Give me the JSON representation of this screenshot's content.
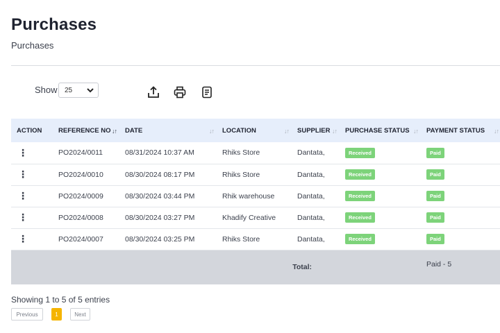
{
  "page": {
    "title": "Purchases",
    "subtitle": "Purchases"
  },
  "controls": {
    "show_label": "Show",
    "page_size": "25",
    "icons": [
      "export-icon",
      "print-icon",
      "document-icon"
    ]
  },
  "table": {
    "columns": [
      "ACTION",
      "REFERENCE NO",
      "DATE",
      "LOCATION",
      "SUPPLIER",
      "PURCHASE STATUS",
      "PAYMENT STATUS"
    ],
    "rows": [
      {
        "action": "⋮",
        "ref": "PO2024/0011",
        "date": "08/31/2024 10:37 AM",
        "location": "Rhiks Store",
        "supplier": "Dantata,",
        "purchase_status": "Received",
        "payment_status": "Paid"
      },
      {
        "action": "⋮",
        "ref": "PO2024/0010",
        "date": "08/30/2024 08:17 PM",
        "location": "Rhiks Store",
        "supplier": "Dantata,",
        "purchase_status": "Received",
        "payment_status": "Paid"
      },
      {
        "action": "⋮",
        "ref": "PO2024/0009",
        "date": "08/30/2024 03:44 PM",
        "location": "Rhik warehouse",
        "supplier": "Dantata,",
        "purchase_status": "Received",
        "payment_status": "Paid"
      },
      {
        "action": "⋮",
        "ref": "PO2024/0008",
        "date": "08/30/2024 03:27 PM",
        "location": "Khadify Creative",
        "supplier": "Dantata,",
        "purchase_status": "Received",
        "payment_status": "Paid"
      },
      {
        "action": "⋮",
        "ref": "PO2024/0007",
        "date": "08/30/2024 03:25 PM",
        "location": "Rhiks Store",
        "supplier": "Dantata,",
        "purchase_status": "Received",
        "payment_status": "Paid"
      }
    ],
    "total_label": "Total:",
    "payment_summary": "Paid - 5"
  },
  "footer": {
    "entries_info": "Showing 1 to 5 of 5 entries",
    "previous": "Previous",
    "current_page": "1",
    "next": "Next"
  },
  "colors": {
    "header_bg": "#e6eefb",
    "badge_green": "#7dd37a",
    "total_bg": "#d3d6dc",
    "active_page": "#f5b400"
  }
}
